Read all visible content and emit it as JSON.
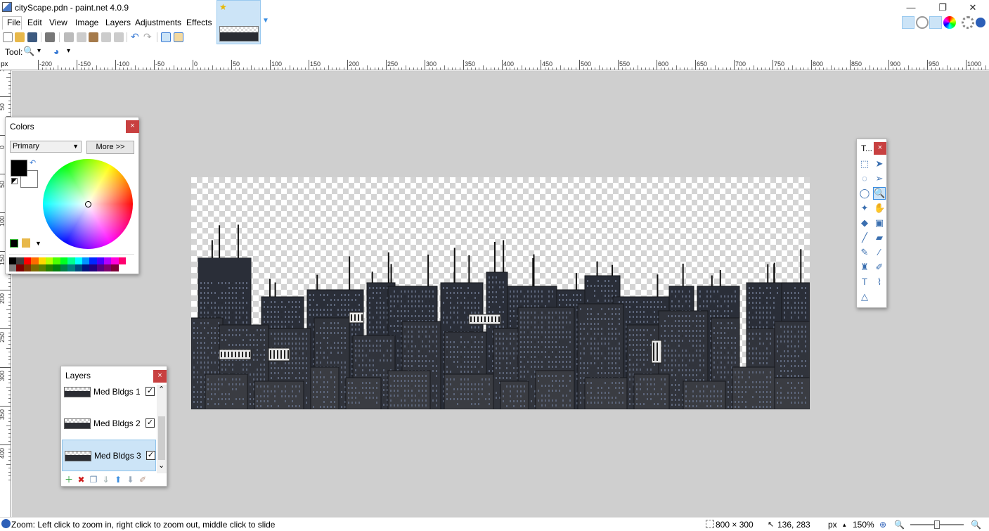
{
  "window": {
    "title": "cityScape.pdn - paint.net 4.0.9",
    "minimize_glyph": "—",
    "restore_glyph": "❐",
    "close_glyph": "✕"
  },
  "menu": [
    "File",
    "Edit",
    "View",
    "Image",
    "Layers",
    "Adjustments",
    "Effects"
  ],
  "toolbar": {
    "icons": [
      "new-image-icon",
      "open-icon",
      "save-icon",
      "print-icon",
      "cut-icon",
      "copy-icon",
      "paste-icon",
      "crop-to-selection-icon",
      "deselect-icon",
      "undo-icon",
      "redo-icon",
      "grid-icon",
      "rulers-icon"
    ]
  },
  "tool_row": {
    "label": "Tool:",
    "tool_glyph": "🔍",
    "dropdown_glyph": "▾",
    "blend_glyph": "◕"
  },
  "ruler": {
    "unit": "px",
    "top_labels": [
      "-200",
      "-150",
      "-100",
      "-50",
      "0",
      "50",
      "100",
      "150",
      "200",
      "250",
      "300",
      "350",
      "400",
      "450",
      "500",
      "550",
      "600",
      "650",
      "700",
      "750",
      "800",
      "850",
      "900",
      "950",
      "1000"
    ],
    "left_labels": [
      "100",
      "50",
      "0",
      "50",
      "100",
      "150",
      "200",
      "250",
      "300",
      "350",
      "400"
    ]
  },
  "colors_panel": {
    "title": "Colors",
    "close_label": "×",
    "mode_select": "Primary",
    "more_button": "More >>",
    "primary_color": "#000000",
    "secondary_color": "#ffffff",
    "palette": [
      "#000000",
      "#404040",
      "#ff0000",
      "#ff6a00",
      "#ffd800",
      "#b6ff00",
      "#4cff00",
      "#00ff21",
      "#00ff90",
      "#00ffff",
      "#0094ff",
      "#0026ff",
      "#4800ff",
      "#b200ff",
      "#ff00dc",
      "#ff006e",
      "#ffffff",
      "#808080",
      "#7f0000",
      "#7f3300",
      "#7f6a00",
      "#5b7f00",
      "#267f00",
      "#007f0e",
      "#007f46",
      "#007f7f",
      "#004a7f",
      "#00137f",
      "#21007f",
      "#57007f",
      "#7f006e",
      "#7f0037"
    ]
  },
  "tools_panel": {
    "title": "T...",
    "close_label": "×",
    "tools": [
      {
        "name": "rectangle-select-icon",
        "glyph": "⬚"
      },
      {
        "name": "move-selected-pixels-icon",
        "glyph": "➤"
      },
      {
        "name": "lasso-select-icon",
        "glyph": "◌"
      },
      {
        "name": "move-selection-icon",
        "glyph": "➢"
      },
      {
        "name": "ellipse-select-icon",
        "glyph": "◯"
      },
      {
        "name": "zoom-icon",
        "glyph": "🔍"
      },
      {
        "name": "magic-wand-icon",
        "glyph": "✦"
      },
      {
        "name": "pan-icon",
        "glyph": "✋"
      },
      {
        "name": "paint-bucket-icon",
        "glyph": "◆"
      },
      {
        "name": "gradient-icon",
        "glyph": "▣"
      },
      {
        "name": "paintbrush-icon",
        "glyph": "╱"
      },
      {
        "name": "eraser-icon",
        "glyph": "▰"
      },
      {
        "name": "pencil-icon",
        "glyph": "✎"
      },
      {
        "name": "color-picker-icon",
        "glyph": "⁄"
      },
      {
        "name": "clone-stamp-icon",
        "glyph": "♜"
      },
      {
        "name": "recolor-icon",
        "glyph": "✐"
      },
      {
        "name": "text-icon",
        "glyph": "T"
      },
      {
        "name": "line-curve-icon",
        "glyph": "⌇"
      },
      {
        "name": "shapes-icon",
        "glyph": "△"
      }
    ]
  },
  "layers_panel": {
    "title": "Layers",
    "close_label": "×",
    "layers": [
      {
        "name": "Med Bldgs 1",
        "visible": "✓",
        "selected": false
      },
      {
        "name": "Med Bldgs 2",
        "visible": "✓",
        "selected": false
      },
      {
        "name": "Med Bldgs 3",
        "visible": "✓",
        "selected": true
      }
    ],
    "scroll_up": "⌃",
    "scroll_down": "⌄",
    "buttons": [
      {
        "name": "add-layer-icon",
        "glyph": "＋",
        "color": "#2e9c3a"
      },
      {
        "name": "delete-layer-icon",
        "glyph": "✖",
        "color": "#d02020"
      },
      {
        "name": "duplicate-layer-icon",
        "glyph": "❐",
        "color": "#6a8bb0"
      },
      {
        "name": "merge-layer-down-icon",
        "glyph": "⇓",
        "color": "#9aa"
      },
      {
        "name": "move-layer-up-icon",
        "glyph": "⬆",
        "color": "#3a8de0"
      },
      {
        "name": "move-layer-down-icon",
        "glyph": "⬇",
        "color": "#9ab"
      },
      {
        "name": "layer-properties-icon",
        "glyph": "✐",
        "color": "#b98"
      }
    ]
  },
  "status": {
    "hint": "Zoom: Left click to zoom in, right click to zoom out, middle click to slide",
    "image_size": "800 × 300",
    "cursor_pos": "136, 283",
    "unit": "px",
    "unit_arrow": "▴",
    "zoom": "150%",
    "zoom_level": 0.5
  }
}
